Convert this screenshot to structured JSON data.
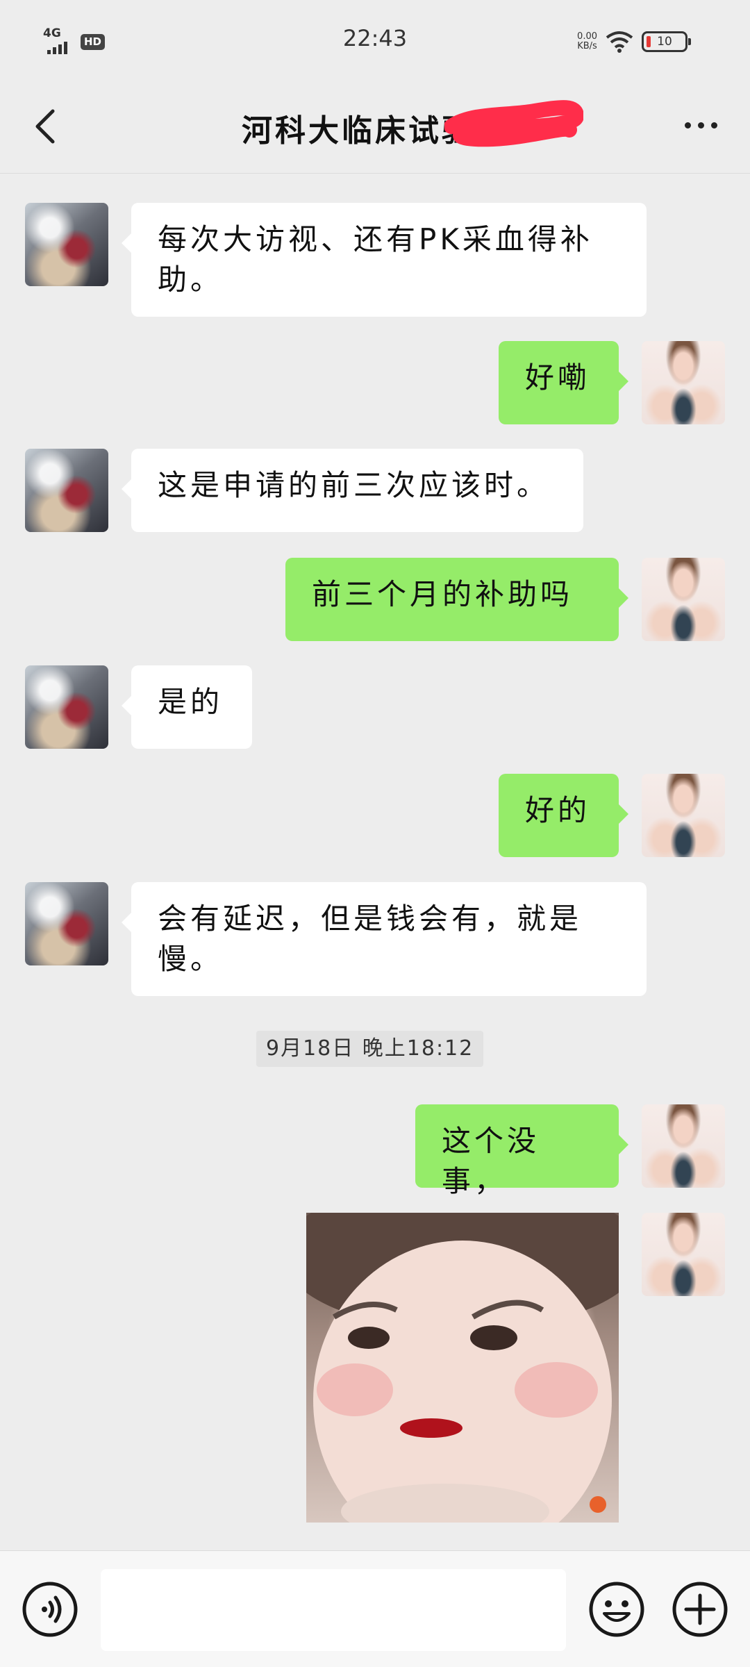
{
  "status_bar": {
    "network": "4G",
    "hd_badge": "HD",
    "time": "22:43",
    "speed_value": "0.00",
    "speed_unit": "KB/s",
    "battery": "10",
    "icons": [
      "signal-icon",
      "wifi-icon",
      "battery-icon"
    ]
  },
  "header": {
    "title": "河科大临床试验王",
    "back_icon": "chevron-left-icon",
    "more_icon": "more-dots-icon"
  },
  "messages": [
    {
      "side": "left",
      "text": "每次大访视、还有PK采血得补助。"
    },
    {
      "side": "right",
      "text": "好嘞"
    },
    {
      "side": "left",
      "text": "这是申请的前三次应该时。"
    },
    {
      "side": "right",
      "text": "前三个月的补助吗"
    },
    {
      "side": "left",
      "text": "是的"
    },
    {
      "side": "right",
      "text": "好的"
    },
    {
      "side": "left",
      "text": "会有延迟，但是钱会有，就是慢。"
    },
    {
      "side": "right",
      "text": "这个没事，"
    },
    {
      "side": "right",
      "type": "image",
      "image": "sticker-photo"
    }
  ],
  "timestamp_divider": "9月18日 晚上18:12",
  "input_bar": {
    "voice_icon": "voice-icon",
    "input_value": "",
    "emoji_icon": "emoji-icon",
    "plus_icon": "plus-icon"
  },
  "colors": {
    "background": "#ededed",
    "sent_bubble": "#95ec69",
    "received_bubble": "#ffffff"
  }
}
